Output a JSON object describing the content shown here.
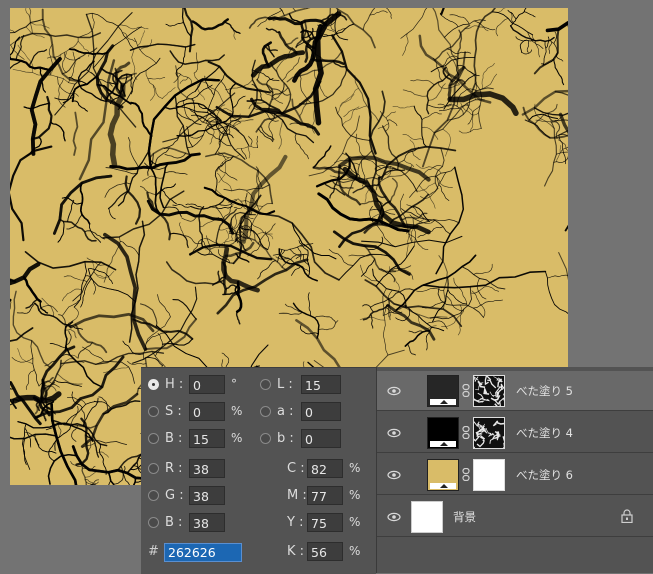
{
  "canvas": {
    "fill": "#d9bc68",
    "crack_color": "#000000"
  },
  "color_picker": {
    "hsb": [
      {
        "label": "H :",
        "value": "0",
        "unit": "°",
        "selected": true
      },
      {
        "label": "S :",
        "value": "0",
        "unit": "%",
        "selected": false
      },
      {
        "label": "B :",
        "value": "15",
        "unit": "%",
        "selected": false
      }
    ],
    "lab": [
      {
        "label": "L :",
        "value": "15"
      },
      {
        "label": "a :",
        "value": "0"
      },
      {
        "label": "b :",
        "value": "0"
      }
    ],
    "rgb": [
      {
        "label": "R :",
        "value": "38"
      },
      {
        "label": "G :",
        "value": "38"
      },
      {
        "label": "B :",
        "value": "38"
      }
    ],
    "cmyk": [
      {
        "label": "C :",
        "value": "82",
        "unit": "%"
      },
      {
        "label": "M :",
        "value": "77",
        "unit": "%"
      },
      {
        "label": "Y :",
        "value": "75",
        "unit": "%"
      },
      {
        "label": "K :",
        "value": "56",
        "unit": "%"
      }
    ],
    "hex_label": "#",
    "hex_value": "262626"
  },
  "layers": [
    {
      "name": "べた塗り 5",
      "fill": "#262626",
      "selected": true,
      "mask": "cracks"
    },
    {
      "name": "べた塗り 4",
      "fill": "#000000",
      "selected": false,
      "mask": "cracks"
    },
    {
      "name": "べた塗り 6",
      "fill": "#d9bc68",
      "selected": false,
      "mask": "white"
    },
    {
      "name": "背景",
      "fill": "#ffffff",
      "selected": false,
      "mask": "none",
      "locked": true
    }
  ]
}
